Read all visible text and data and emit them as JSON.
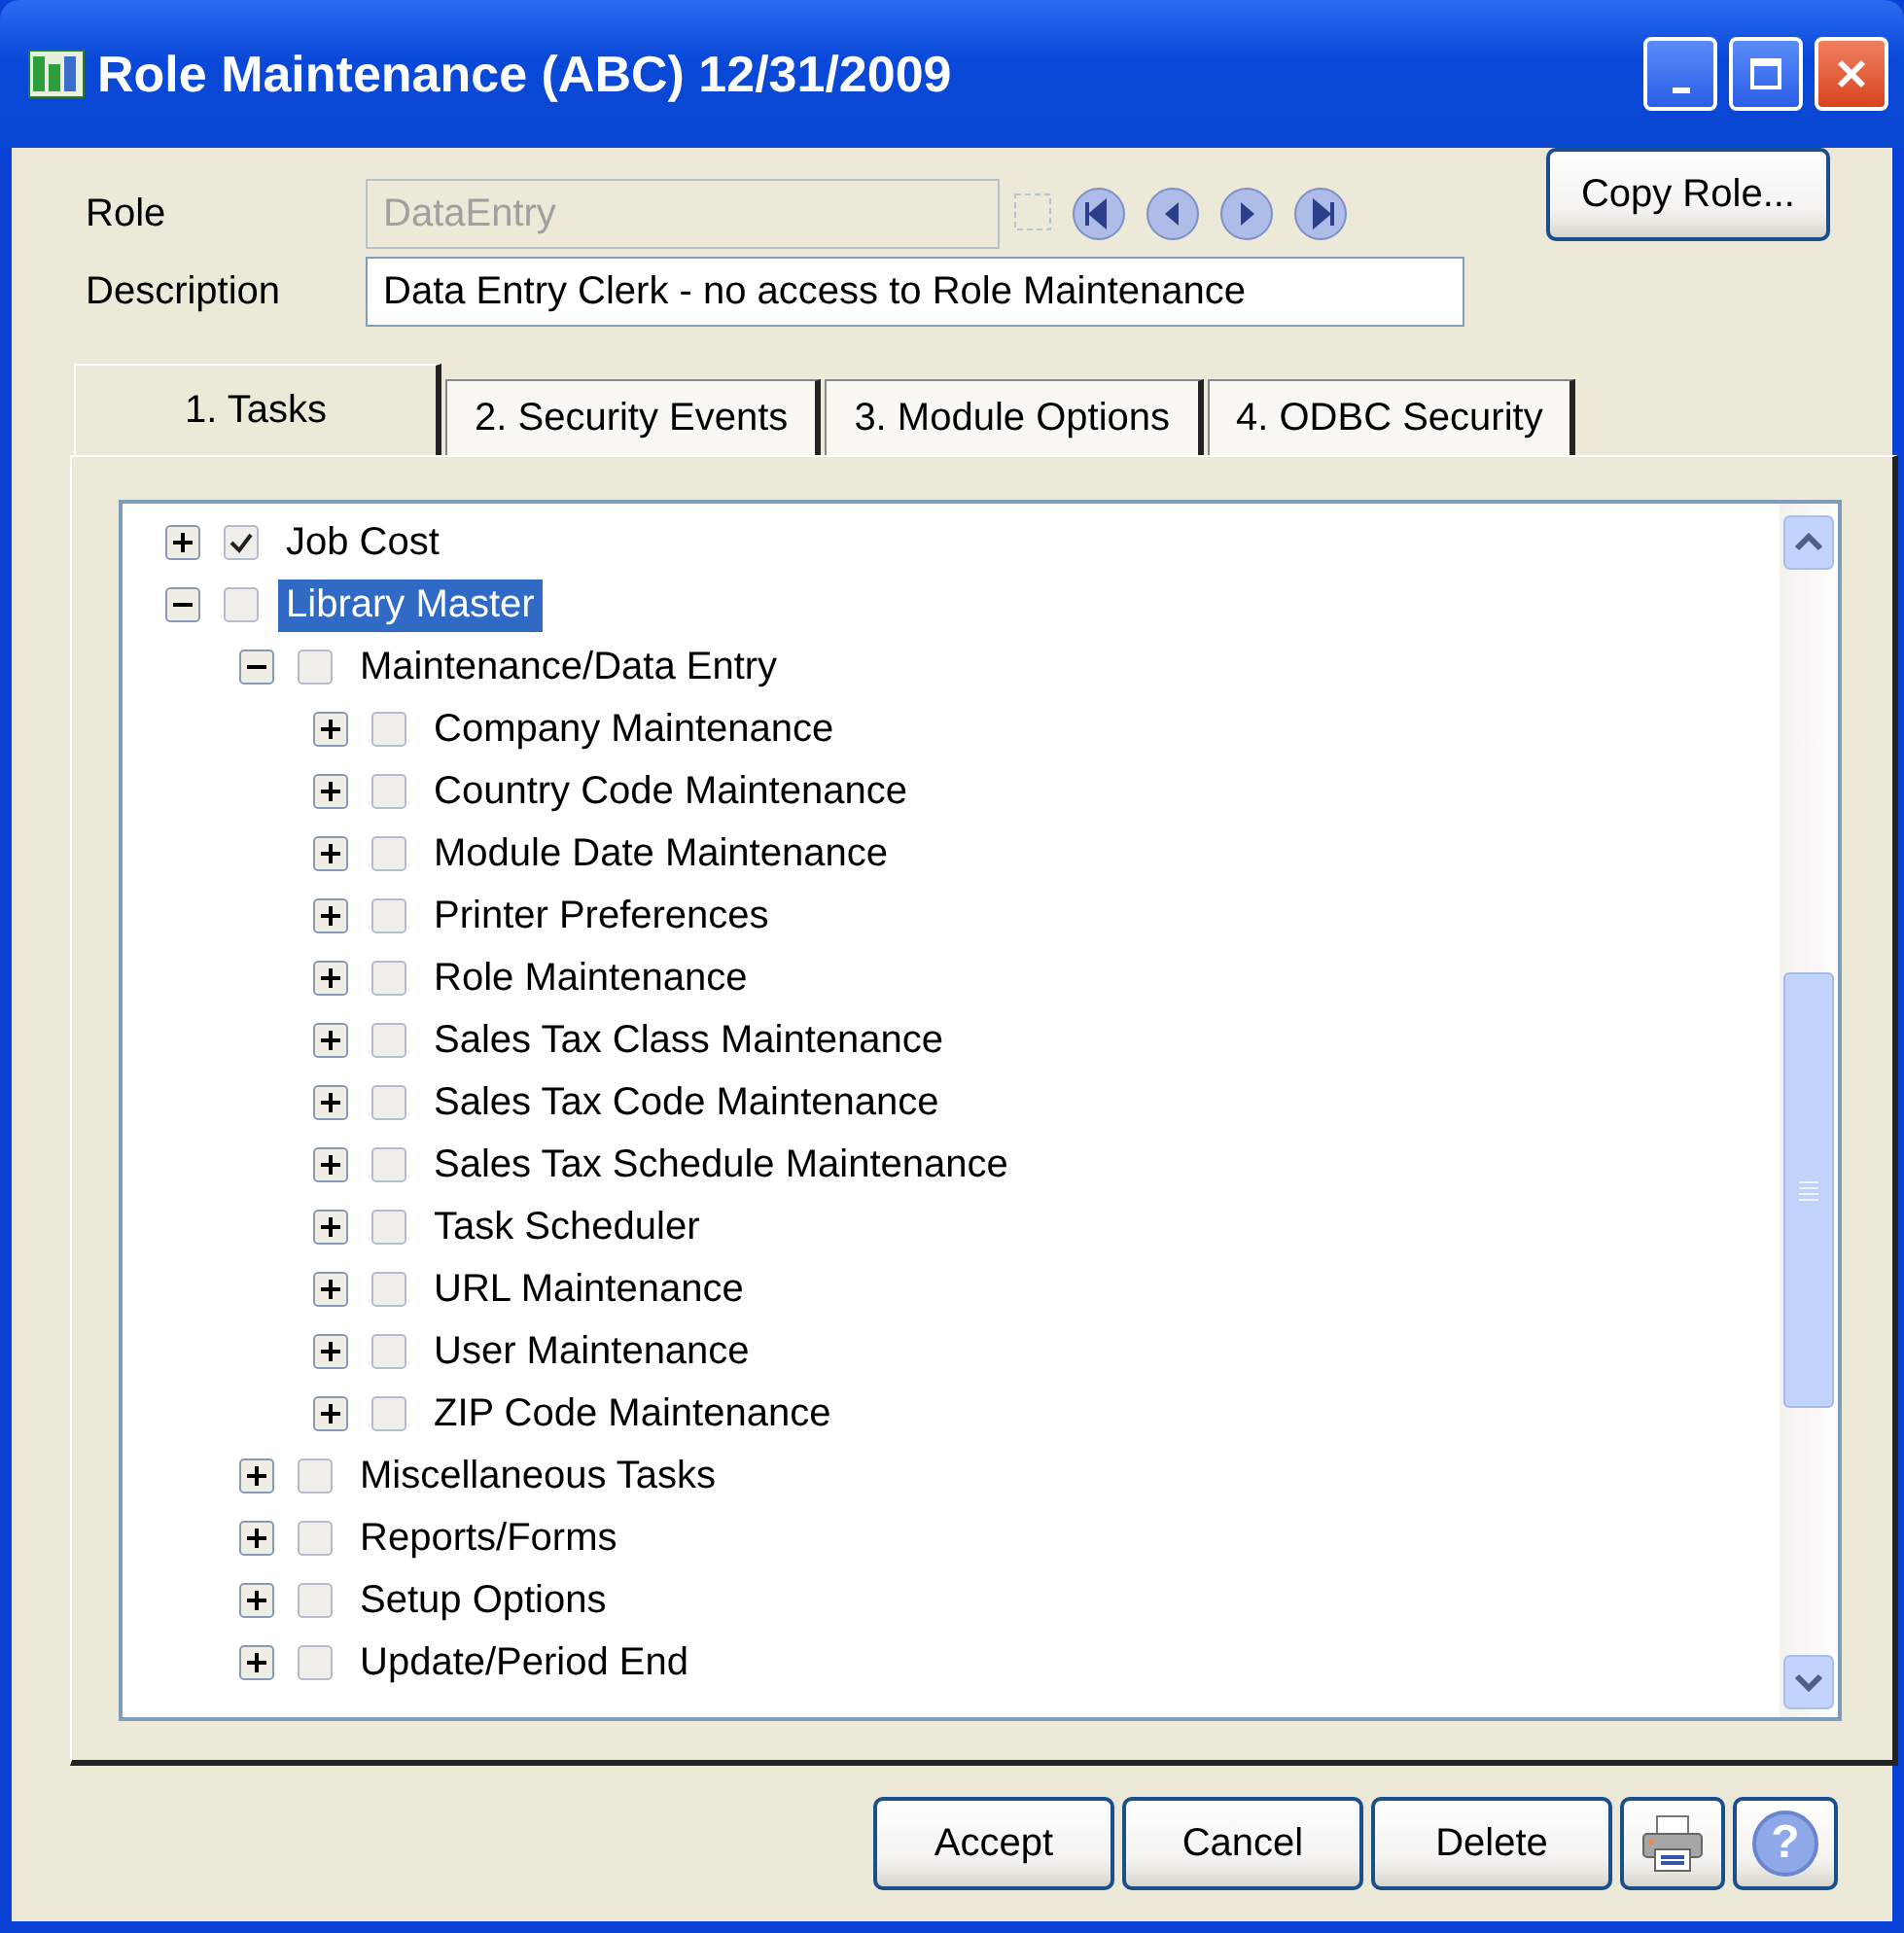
{
  "window": {
    "title": "Role Maintenance (ABC) 12/31/2009"
  },
  "form": {
    "role_label": "Role",
    "role_value": "DataEntry",
    "role_disabled": true,
    "description_label": "Description",
    "description_value": "Data Entry Clerk - no access to Role Maintenance",
    "copy_button": "Copy Role..."
  },
  "tabs": [
    {
      "label": "1. Tasks",
      "selected": true
    },
    {
      "label": "2. Security Events",
      "selected": false
    },
    {
      "label": "3. Module Options",
      "selected": false
    },
    {
      "label": "4. ODBC Security",
      "selected": false
    }
  ],
  "tree": [
    {
      "label": "Job Cost",
      "checked": true,
      "expanded": false,
      "selected": false
    },
    {
      "label": "Library Master",
      "checked": false,
      "expanded": true,
      "selected": true,
      "children": [
        {
          "label": "Maintenance/Data Entry",
          "checked": false,
          "expanded": true,
          "selected": false,
          "children": [
            {
              "label": "Company Maintenance",
              "checked": false,
              "expanded": false,
              "selected": false
            },
            {
              "label": "Country Code Maintenance",
              "checked": false,
              "expanded": false,
              "selected": false
            },
            {
              "label": "Module Date Maintenance",
              "checked": false,
              "expanded": false,
              "selected": false
            },
            {
              "label": "Printer Preferences",
              "checked": false,
              "expanded": false,
              "selected": false
            },
            {
              "label": "Role Maintenance",
              "checked": false,
              "expanded": false,
              "selected": false
            },
            {
              "label": "Sales Tax Class Maintenance",
              "checked": false,
              "expanded": false,
              "selected": false
            },
            {
              "label": "Sales Tax Code Maintenance",
              "checked": false,
              "expanded": false,
              "selected": false
            },
            {
              "label": "Sales Tax Schedule Maintenance",
              "checked": false,
              "expanded": false,
              "selected": false
            },
            {
              "label": "Task Scheduler",
              "checked": false,
              "expanded": false,
              "selected": false
            },
            {
              "label": "URL Maintenance",
              "checked": false,
              "expanded": false,
              "selected": false
            },
            {
              "label": "User Maintenance",
              "checked": false,
              "expanded": false,
              "selected": false
            },
            {
              "label": "ZIP Code Maintenance",
              "checked": false,
              "expanded": false,
              "selected": false
            }
          ]
        },
        {
          "label": "Miscellaneous Tasks",
          "checked": false,
          "expanded": false,
          "selected": false
        },
        {
          "label": "Reports/Forms",
          "checked": false,
          "expanded": false,
          "selected": false
        },
        {
          "label": "Setup Options",
          "checked": false,
          "expanded": false,
          "selected": false
        },
        {
          "label": "Update/Period End",
          "checked": false,
          "expanded": false,
          "selected": false
        }
      ]
    }
  ],
  "buttons": [
    {
      "kind": "text",
      "label": "Accept"
    },
    {
      "kind": "text",
      "label": "Cancel"
    },
    {
      "kind": "text",
      "label": "Delete"
    },
    {
      "kind": "print"
    },
    {
      "kind": "help",
      "label": "?"
    }
  ]
}
